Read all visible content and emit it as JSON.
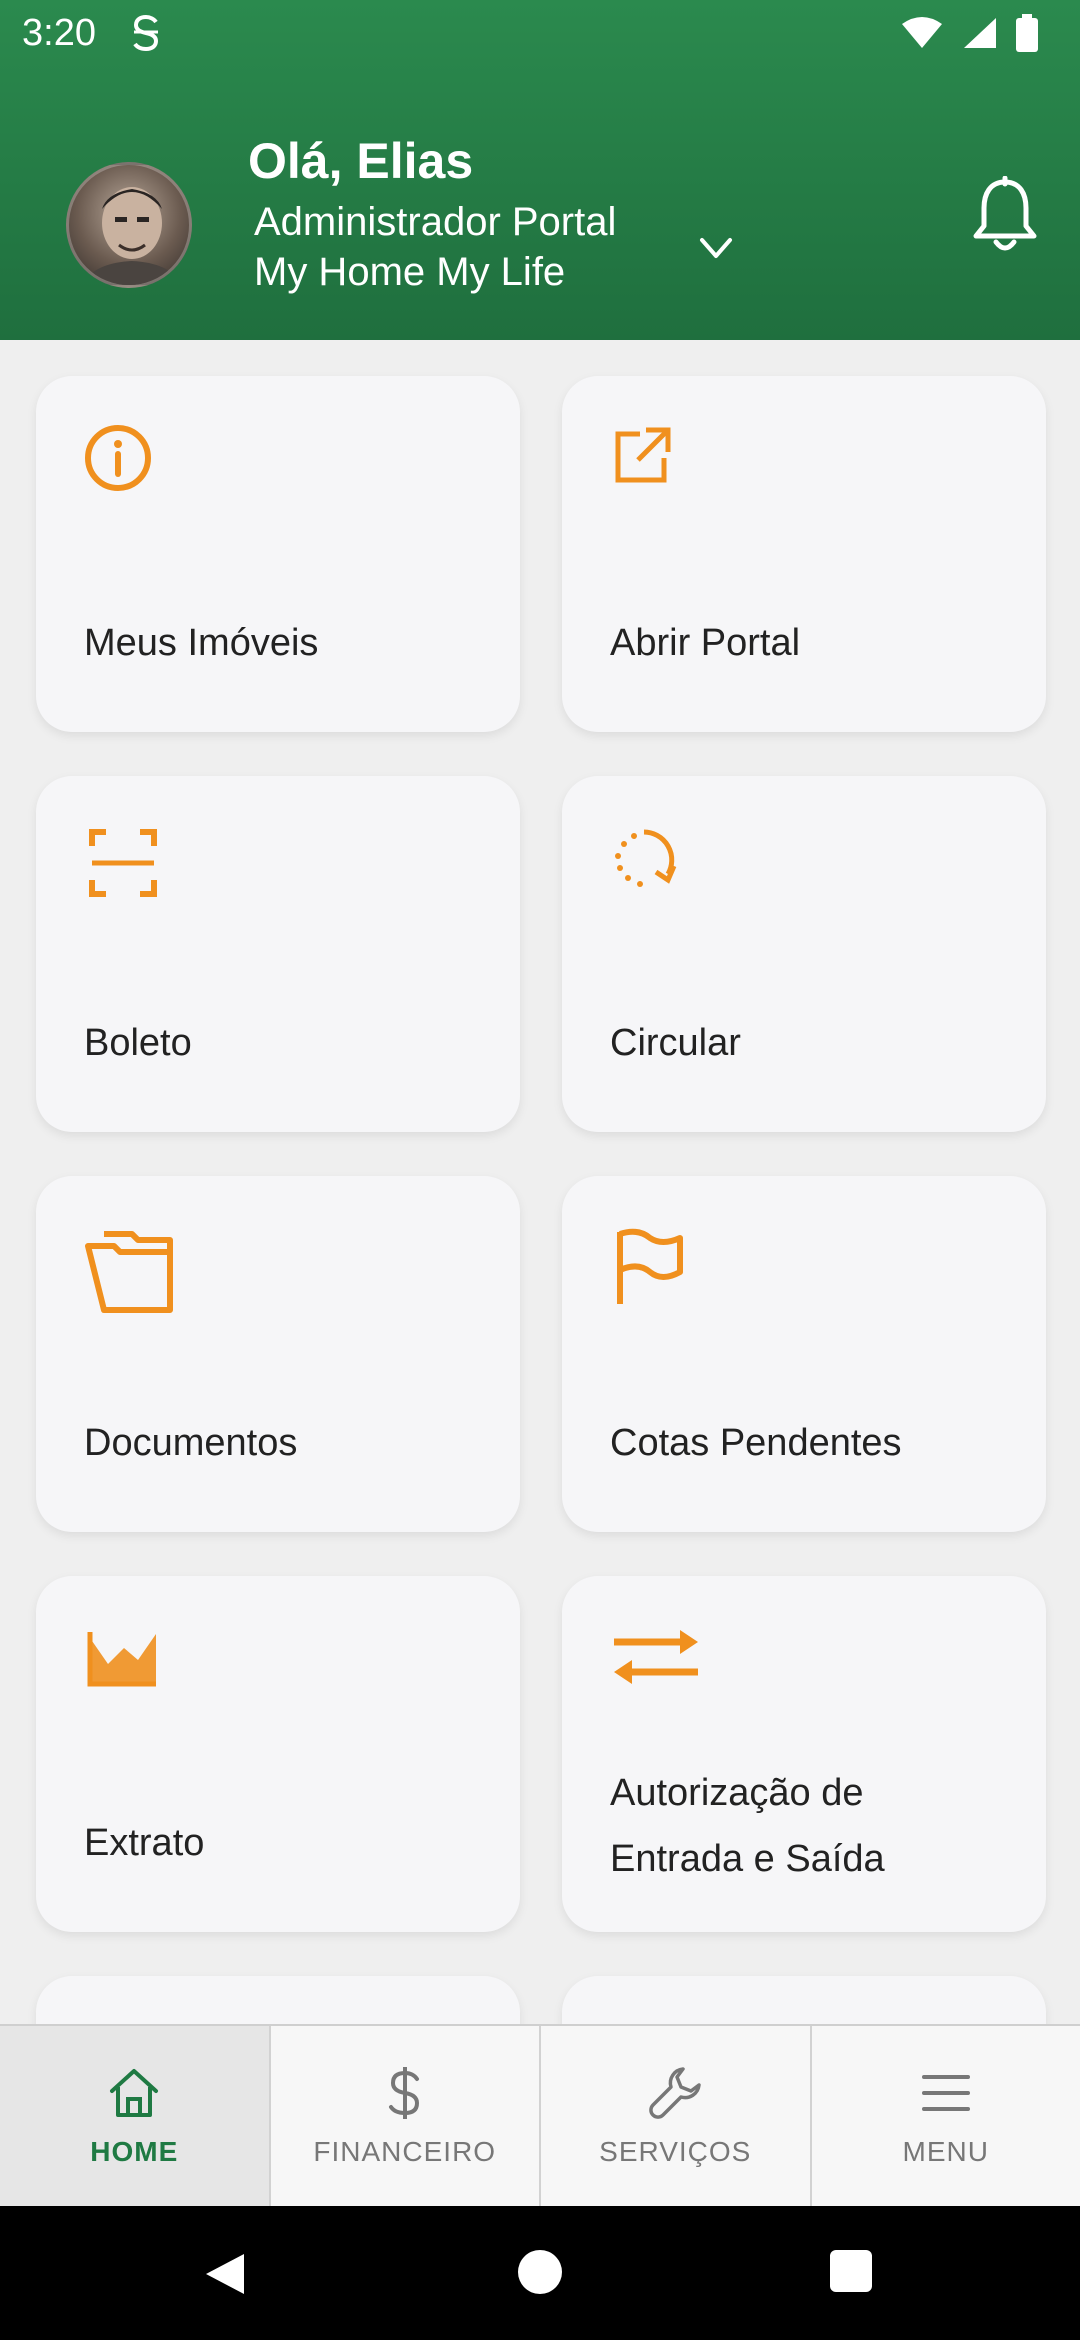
{
  "status_bar": {
    "time": "3:20"
  },
  "header": {
    "greeting": "Olá, Elias",
    "portal_line1": "Administrador Portal",
    "portal_line2": "My Home My Life"
  },
  "colors": {
    "brand_green": "#1f7a43",
    "accent_orange": "#f0901e",
    "card_bg": "#f6f6f8"
  },
  "cards": [
    {
      "label": "Meus Imóveis",
      "icon": "info-icon"
    },
    {
      "label": "Abrir Portal",
      "icon": "external-link-icon"
    },
    {
      "label": "Boleto",
      "icon": "barcode-scan-icon"
    },
    {
      "label": "Circular",
      "icon": "refresh-dotted-icon"
    },
    {
      "label": "Documentos",
      "icon": "folder-icon"
    },
    {
      "label": "Cotas Pendentes",
      "icon": "flag-icon"
    },
    {
      "label": "Extrato",
      "icon": "area-chart-icon"
    },
    {
      "label_line1": "Autorização de",
      "label_line2": "Entrada e Saída",
      "icon": "swap-arrows-icon"
    }
  ],
  "bottom_nav": [
    {
      "label": "HOME",
      "icon": "home-icon",
      "active": true
    },
    {
      "label": "FINANCEIRO",
      "icon": "dollar-icon"
    },
    {
      "label": "SERVIÇOS",
      "icon": "wrench-icon"
    },
    {
      "label": "MENU",
      "icon": "hamburger-menu-icon"
    }
  ]
}
